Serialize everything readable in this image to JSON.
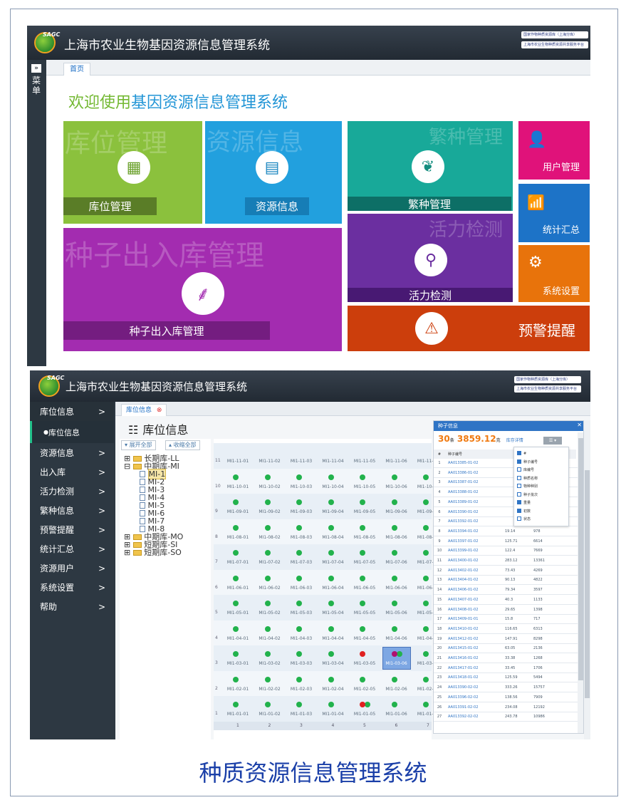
{
  "app": {
    "logo_text": "SAGC",
    "system_name": "上海市农业生物基因资源信息管理系统",
    "badge1": "国家作物种质资源库（上海分库）",
    "badge2": "上海市农业生物种质资源共享服务平台"
  },
  "dashboard": {
    "menu_label": "菜单",
    "tab_home": "首页",
    "welcome_prefix": "欢迎使用",
    "welcome_highlight": "基因资源信息管理系统",
    "tiles": {
      "storage": {
        "label": "库位管理",
        "watermark": "库位管理",
        "color": "#8bc13d"
      },
      "resource": {
        "label": "资源信息",
        "watermark": "资源信息",
        "color": "#22a0de"
      },
      "breeding": {
        "label": "繁种管理",
        "watermark": "繁种管理",
        "color": "#18a999"
      },
      "user": {
        "label": "用户管理",
        "color": "#e0127a"
      },
      "stats": {
        "label": "统计汇总",
        "color": "#1d73c7"
      },
      "settings": {
        "label": "系统设置",
        "color": "#e8730b"
      },
      "seedio": {
        "label": "种子出入库管理",
        "watermark": "种子出入库管理",
        "color": "#a32cb0"
      },
      "vitality": {
        "label": "活力检测",
        "watermark": "活力检测",
        "color": "#6b2fa0"
      },
      "warning": {
        "label": "预警提醒",
        "color": "#cc3e0c"
      }
    }
  },
  "storage": {
    "nav": [
      {
        "label": "库位信息",
        "arrow": ">"
      },
      {
        "label": "库位信息"
      },
      {
        "label": "资源信息",
        "arrow": ">"
      },
      {
        "label": "出入库",
        "arrow": ">"
      },
      {
        "label": "活力检测",
        "arrow": ">"
      },
      {
        "label": "繁种信息",
        "arrow": ">"
      },
      {
        "label": "预警提醒",
        "arrow": ">"
      },
      {
        "label": "统计汇总",
        "arrow": ">"
      },
      {
        "label": "资源用户",
        "arrow": ">"
      },
      {
        "label": "系统设置",
        "arrow": ">"
      },
      {
        "label": "帮助",
        "arrow": ">"
      }
    ],
    "tab": "库位信息",
    "page_title": "库位信息",
    "expand_all": "展开全部",
    "collapse_all": "收缩全部",
    "tree": [
      "长期库-LL",
      "中期库-MI",
      "MI-1",
      "MI-2",
      "MI-3",
      "MI-4",
      "MI-5",
      "MI-6",
      "MI-7",
      "MI-8",
      "中期库-MO",
      "短期库-SI",
      "短期库-SO"
    ],
    "grid_rows": [
      "11",
      "10",
      "9",
      "8",
      "7",
      "6",
      "5",
      "4",
      "3",
      "2",
      "1"
    ],
    "grid_cols": [
      "1",
      "2",
      "3",
      "4",
      "5",
      "6",
      "7"
    ],
    "panel": {
      "title": "种子信息",
      "count": "30",
      "count_unit": "条",
      "weight": "3859.12",
      "weight_unit": "克",
      "link": "库存详情",
      "col_no": "#",
      "col_id": "种子编号",
      "options": [
        "#",
        "种子编号",
        "库编号",
        "种质名称",
        "物种种别",
        "种子批次",
        "重量",
        "初数",
        "状态"
      ],
      "rows": [
        [
          "1",
          "AA013385-01-02",
          "",
          ""
        ],
        [
          "2",
          "AA013386-01-02",
          "",
          ""
        ],
        [
          "3",
          "AA013387-01-02",
          "",
          ""
        ],
        [
          "4",
          "AA013388-01-02",
          "",
          ""
        ],
        [
          "5",
          "AA013389-01-02",
          "",
          ""
        ],
        [
          "6",
          "AA013390-01-02",
          "",
          ""
        ],
        [
          "7",
          "AA013392-01-02",
          "",
          ""
        ],
        [
          "8",
          "AA013394-01-02",
          "19.14",
          "978"
        ],
        [
          "9",
          "AA013397-01-02",
          "125.71",
          "6614"
        ],
        [
          "10",
          "AA013399-01-02",
          "122.4",
          "7669"
        ],
        [
          "11",
          "AA013400-01-02",
          "283.12",
          "13361"
        ],
        [
          "12",
          "AA013402-01-02",
          "73.43",
          "4269"
        ],
        [
          "13",
          "AA013404-01-02",
          "90.13",
          "4822"
        ],
        [
          "14",
          "AA013406-01-02",
          "79.34",
          "3597"
        ],
        [
          "15",
          "AA013407-01-02",
          "40.3",
          "1133"
        ],
        [
          "16",
          "AA013408-01-02",
          "29.65",
          "1398"
        ],
        [
          "17",
          "AA013409-01-01",
          "15.8",
          "717"
        ],
        [
          "18",
          "AA013410-01-02",
          "116.65",
          "6313"
        ],
        [
          "19",
          "AA013412-01-02",
          "147.91",
          "8298"
        ],
        [
          "20",
          "AA013415-01-02",
          "63.05",
          "2136"
        ],
        [
          "21",
          "AA013416-01-02",
          "33.38",
          "1268"
        ],
        [
          "22",
          "AA013417-01-02",
          "33.45",
          "1706"
        ],
        [
          "23",
          "AA013418-01-02",
          "125.59",
          "5494"
        ],
        [
          "24",
          "AA013390-02-02",
          "333.26",
          "15757"
        ],
        [
          "25",
          "AA013396-02-02",
          "138.56",
          "7909"
        ],
        [
          "26",
          "AA013391-02-02",
          "234.08",
          "12192"
        ],
        [
          "27",
          "AA013392-02-02",
          "243.78",
          "10986"
        ]
      ]
    }
  },
  "caption": "种质资源信息管理系统",
  "colors": {
    "header": "#2a333d",
    "sidebar": "#2d3842",
    "caption": "#1a3fa8",
    "selected": "#2f74c5"
  }
}
